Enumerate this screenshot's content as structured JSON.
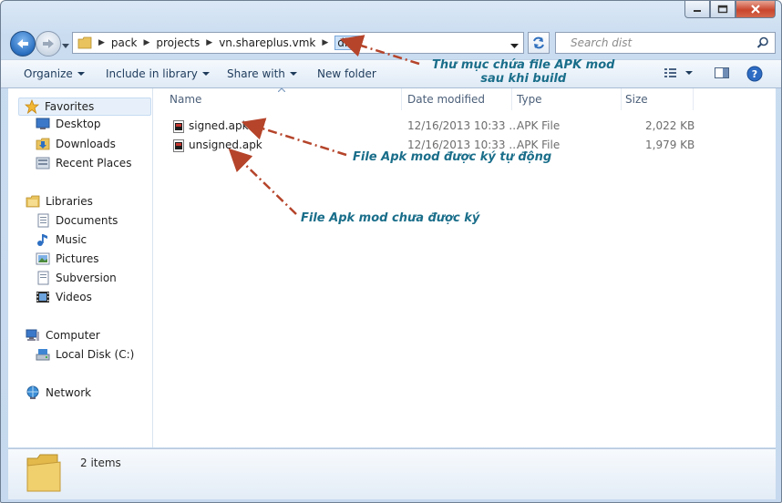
{
  "window": {
    "controls": {
      "minimize_icon": "minimize-icon",
      "maximize_icon": "maximize-icon",
      "close_icon": "close-icon"
    }
  },
  "address_bar": {
    "breadcrumbs": [
      "pack",
      "projects",
      "vn.shareplus.vmk",
      "dist"
    ]
  },
  "search": {
    "placeholder": "Search dist"
  },
  "toolbar": {
    "organize": "Organize",
    "include_in_library": "Include in library",
    "share_with": "Share with",
    "new_folder": "New folder"
  },
  "navigation": {
    "favorites": {
      "label": "Favorites",
      "items": [
        "Desktop",
        "Downloads",
        "Recent Places"
      ]
    },
    "libraries": {
      "label": "Libraries",
      "items": [
        "Documents",
        "Music",
        "Pictures",
        "Subversion",
        "Videos"
      ]
    },
    "computer": {
      "label": "Computer",
      "items": [
        "Local Disk (C:)"
      ]
    },
    "network": {
      "label": "Network"
    }
  },
  "file_list": {
    "columns": [
      "Name",
      "Date modified",
      "Type",
      "Size"
    ],
    "rows": [
      {
        "name": "signed.apk",
        "date": "12/16/2013 10:33 ...",
        "type": "APK File",
        "size": "2,022 KB"
      },
      {
        "name": "unsigned.apk",
        "date": "12/16/2013 10:33 ...",
        "type": "APK File",
        "size": "1,979 KB"
      }
    ]
  },
  "details": {
    "count": "2 items"
  },
  "annotations": {
    "folder_line1": "Thư mục chứa file APK mod",
    "folder_line2": "sau khi build",
    "signed": "File Apk mod được ký tự động",
    "unsigned": "File Apk mod chưa được ký",
    "arrow_color": "#b5442a"
  },
  "colors": {
    "title_gradient_top": "#dbe8f6",
    "selection": "#cde3f9",
    "annotation_text": "#1a6e8a"
  }
}
